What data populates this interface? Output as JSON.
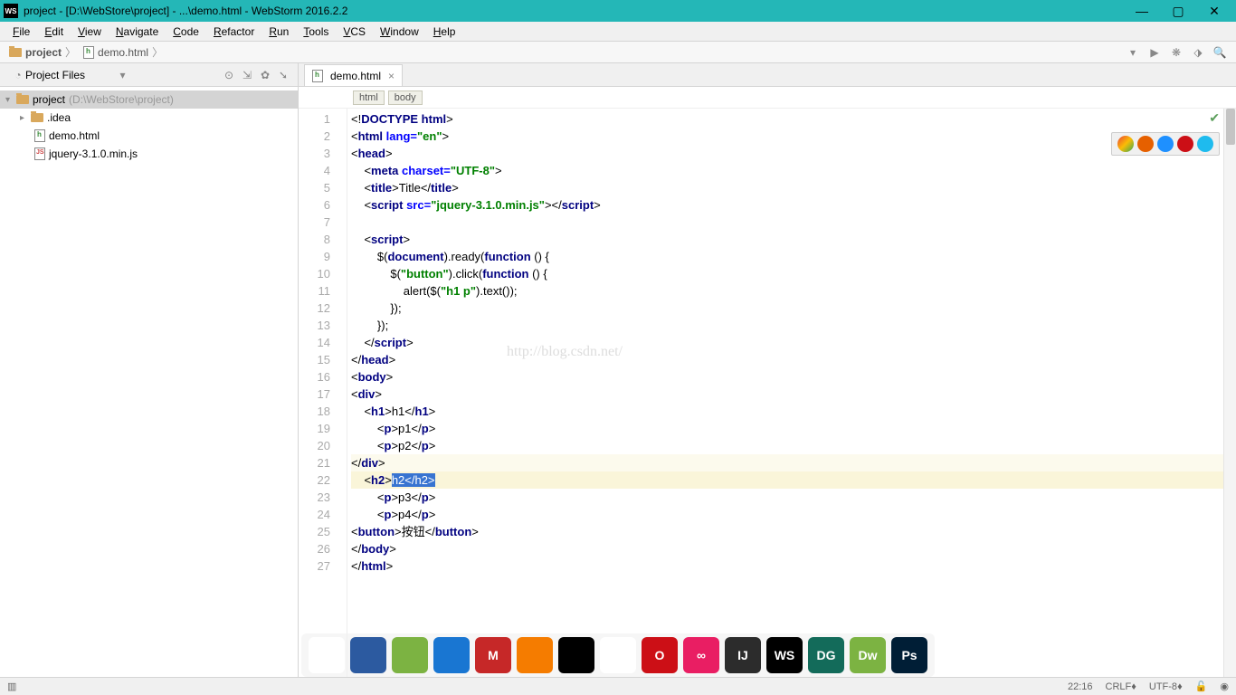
{
  "title": "project - [D:\\WebStore\\project] - ...\\demo.html - WebStorm 2016.2.2",
  "menus": [
    "File",
    "Edit",
    "View",
    "Navigate",
    "Code",
    "Refactor",
    "Run",
    "Tools",
    "VCS",
    "Window",
    "Help"
  ],
  "breadcrumb": {
    "project": "project",
    "file": "demo.html"
  },
  "sidebar": {
    "title": "Project Files",
    "root": {
      "name": "project",
      "path": "(D:\\WebStore\\project)"
    },
    "items": [
      {
        "name": ".idea",
        "type": "folder"
      },
      {
        "name": "demo.html",
        "type": "html"
      },
      {
        "name": "jquery-3.1.0.min.js",
        "type": "js"
      }
    ]
  },
  "tab": {
    "name": "demo.html"
  },
  "crumbs": [
    "html",
    "body"
  ],
  "lines_count": 27,
  "watermark": "http://blog.csdn.net/",
  "status": {
    "pos": "22:16",
    "lineend": "CRLF",
    "enc": "UTF-8"
  },
  "browsers": [
    {
      "name": "chrome",
      "c": "#fff",
      "b": "linear-gradient(135deg,#ea4335,#fbbc05 50%,#34a853)"
    },
    {
      "name": "firefox",
      "c": "#fff",
      "b": "#e66000"
    },
    {
      "name": "safari",
      "c": "#fff",
      "b": "#1e90ff"
    },
    {
      "name": "opera",
      "c": "#fff",
      "b": "#cc0f16"
    },
    {
      "name": "ie",
      "c": "#fff",
      "b": "#1ebbee"
    }
  ],
  "dock": [
    {
      "bg": "#fff",
      "label": "",
      "name": "app1"
    },
    {
      "bg": "#2c5aa0",
      "label": "",
      "name": "app2"
    },
    {
      "bg": "#7cb342",
      "label": "",
      "name": "app3"
    },
    {
      "bg": "#1976d2",
      "label": "",
      "name": "app4"
    },
    {
      "bg": "#c62828",
      "label": "M",
      "name": "app5"
    },
    {
      "bg": "#f57c00",
      "label": "",
      "name": "app6"
    },
    {
      "bg": "#000",
      "label": "",
      "name": "qq"
    },
    {
      "bg": "#fff",
      "label": "",
      "name": "chrome"
    },
    {
      "bg": "#cc0f16",
      "label": "O",
      "name": "opera"
    },
    {
      "bg": "#e91e63",
      "label": "∞",
      "name": "app9"
    },
    {
      "bg": "#2c2c2c",
      "label": "IJ",
      "name": "intellij"
    },
    {
      "bg": "#000",
      "label": "WS",
      "name": "webstorm"
    },
    {
      "bg": "#136b5a",
      "label": "DG",
      "name": "datagrip"
    },
    {
      "bg": "#7cb342",
      "label": "Dw",
      "name": "dreamweaver"
    },
    {
      "bg": "#001e36",
      "label": "Ps",
      "name": "photoshop"
    }
  ]
}
